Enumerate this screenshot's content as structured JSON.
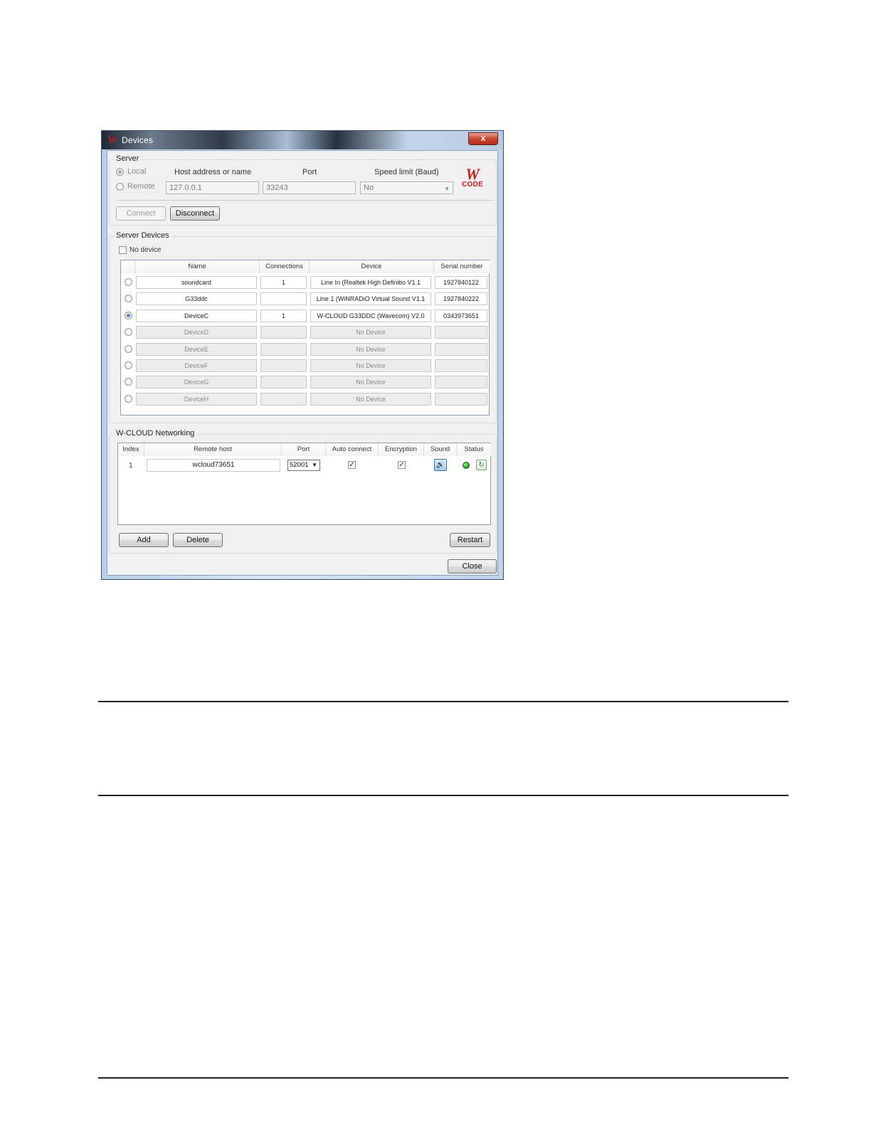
{
  "window": {
    "title": "Devices",
    "close_glyph": "x"
  },
  "server": {
    "group_label": "Server",
    "local_label": "Local",
    "remote_label": "Remote",
    "host_header": "Host address or name",
    "port_header": "Port",
    "speed_header": "Speed limit (Baud)",
    "host_value": "127.0.0.1",
    "port_value": "33243",
    "speed_value": "No",
    "connect_label": "Connect",
    "disconnect_label": "Disconnect",
    "logo_w": "W",
    "logo_code": "CODE"
  },
  "server_devices": {
    "group_label": "Server Devices",
    "no_device_label": "No device",
    "columns": [
      "Name",
      "Connections",
      "Device",
      "Serial number"
    ],
    "rows": [
      {
        "name": "soundcard",
        "connections": "1",
        "device": "Line In (Realtek High Definitio V1.1",
        "serial": "1927840122",
        "selected": false,
        "active": true
      },
      {
        "name": "G33ddc",
        "connections": "",
        "device": "Line 1 (WiNRADiO Virtual Sound  V1.1",
        "serial": "1927840222",
        "selected": false,
        "active": true
      },
      {
        "name": "DeviceC",
        "connections": "1",
        "device": "W-CLOUD G33DDC (Wavecom) V2.0",
        "serial": "0343973651",
        "selected": true,
        "active": true
      },
      {
        "name": "DeviceD",
        "connections": "",
        "device": "No Device",
        "serial": "",
        "selected": false,
        "active": false
      },
      {
        "name": "DeviceE",
        "connections": "",
        "device": "No Device",
        "serial": "",
        "selected": false,
        "active": false
      },
      {
        "name": "DeviceF",
        "connections": "",
        "device": "No Device",
        "serial": "",
        "selected": false,
        "active": false
      },
      {
        "name": "DeviceG",
        "connections": "",
        "device": "No Device",
        "serial": "",
        "selected": false,
        "active": false
      },
      {
        "name": "DeviceH",
        "connections": "",
        "device": "No Device",
        "serial": "",
        "selected": false,
        "active": false
      }
    ]
  },
  "networking": {
    "group_label": "W-CLOUD Networking",
    "columns": [
      "Index",
      "Remote host",
      "Port",
      "Auto connect",
      "Encryption",
      "Sound",
      "Status"
    ],
    "rows": [
      {
        "index": "1",
        "remote_host": "wcloud73651",
        "port": "52001",
        "auto_connect": true,
        "encryption": true,
        "sound_icon": "speaker-icon",
        "status_icon": "status-green-icon",
        "refresh_icon": "refresh-icon"
      }
    ],
    "check_glyph": "✓",
    "add_label": "Add",
    "delete_label": "Delete",
    "restart_label": "Restart"
  },
  "footer": {
    "close_label": "Close"
  }
}
